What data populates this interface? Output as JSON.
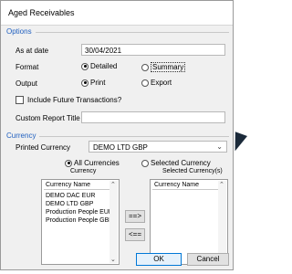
{
  "window": {
    "title": "Aged Receivables"
  },
  "options": {
    "group_label": "Options",
    "as_at_date_label": "As at date",
    "as_at_date_value": "30/04/2021",
    "format_label": "Format",
    "format_detailed": "Detailed",
    "format_summary": "Summary",
    "output_label": "Output",
    "output_print": "Print",
    "output_export": "Export",
    "include_future_label": "Include Future Transactions?",
    "custom_title_label": "Custom Report Title",
    "custom_title_value": ""
  },
  "currency": {
    "group_label": "Currency",
    "printed_currency_label": "Printed Currency",
    "printed_currency_value": "DEMO LTD GBP",
    "all_currencies": "All Currencies",
    "selected_currency": "Selected Currency",
    "left_caption": "Currency",
    "right_caption": "Selected Currency(s)",
    "left_list": {
      "header": "Currency Name",
      "items": [
        "DEMO DAC EUR",
        "DEMO LTD GBP",
        "Production People EUR",
        "Production People GBP"
      ]
    },
    "right_list": {
      "header": "Currency Name"
    },
    "add_btn": "==>",
    "remove_btn": "<=="
  },
  "footer": {
    "ok": "OK",
    "cancel": "Cancel"
  }
}
